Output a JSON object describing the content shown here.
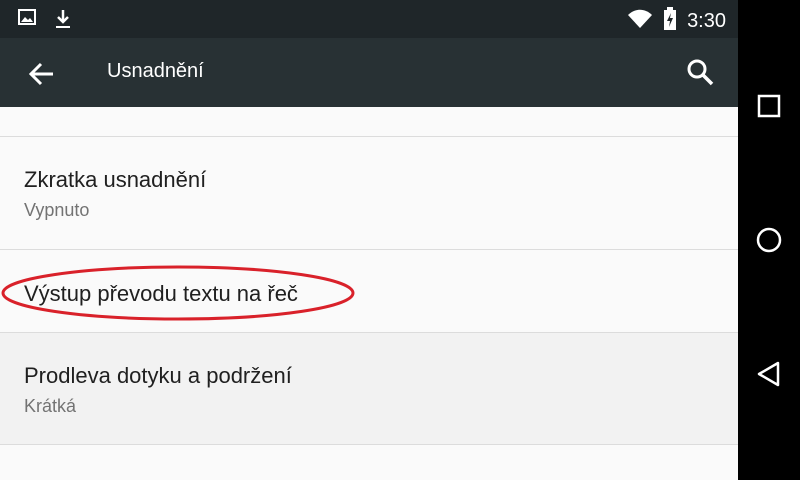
{
  "status_bar": {
    "time": "3:30",
    "icons": [
      "image-icon",
      "download-icon",
      "wifi-icon",
      "battery-charging-icon"
    ]
  },
  "toolbar": {
    "title": "Usnadnění",
    "back_icon": "arrow-left-icon",
    "search_icon": "search-icon"
  },
  "settings": {
    "items": [
      {
        "title": "Zkratka usnadnění",
        "subtitle": "Vypnuto"
      },
      {
        "title": "Výstup převodu textu na řeč",
        "subtitle": ""
      },
      {
        "title": "Prodleva dotyku a podržení",
        "subtitle": "Krátká"
      }
    ]
  },
  "nav_bar": {
    "buttons": [
      "recents-icon",
      "home-icon",
      "back-icon"
    ]
  },
  "colors": {
    "status_bar": "#1f2629",
    "toolbar": "#283134",
    "highlight": "#d9212a",
    "pressed_row": "#f2f2f2"
  }
}
